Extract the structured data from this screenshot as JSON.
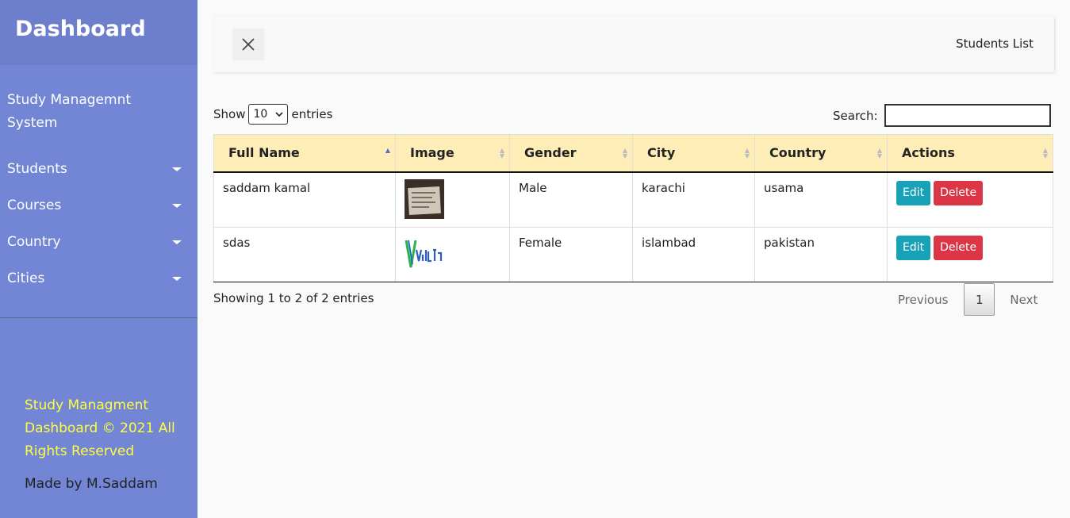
{
  "sidebar": {
    "title": "Dashboard",
    "subtitle": "Study Managemnt System",
    "items": [
      {
        "label": "Students"
      },
      {
        "label": "Courses"
      },
      {
        "label": "Country"
      },
      {
        "label": "Cities"
      }
    ],
    "footer_text": "Study Managment Dashboard © 2021 All Rights Reserved",
    "made_by": "Made by M.Saddam"
  },
  "topbar": {
    "title": "Students List"
  },
  "table_controls": {
    "show_label": "Show",
    "entries_value": "10",
    "entries_label": "entries",
    "search_label": "Search:",
    "search_value": ""
  },
  "table": {
    "headers": [
      "Full Name",
      "Image",
      "Gender",
      "City",
      "Country",
      "Actions"
    ],
    "rows": [
      {
        "full_name": "saddam kamal",
        "gender": "Male",
        "city": "karachi",
        "country": "usama",
        "image_icon": "photo-thumbnail"
      },
      {
        "full_name": "sdas",
        "gender": "Female",
        "city": "islambad",
        "country": "pakistan",
        "image_icon": "vaultspay-logo"
      }
    ],
    "edit_label": "Edit",
    "delete_label": "Delete"
  },
  "pagination": {
    "info": "Showing 1 to 2 of 2 entries",
    "previous": "Previous",
    "current_page": "1",
    "next": "Next"
  },
  "colors": {
    "sidebar_bg": "#7386d5",
    "sidebar_header_bg": "#6d7fcc",
    "table_header_bg": "#ffedb8",
    "edit_button": "#17a2b8",
    "delete_button": "#dc3545",
    "footer_text": "#ffff3c"
  }
}
